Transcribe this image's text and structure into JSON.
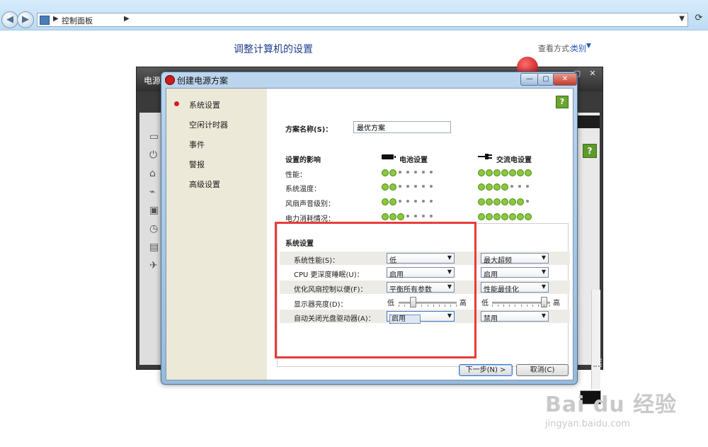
{
  "explorer": {
    "breadcrumb": "控制面板",
    "page_title": "调整计算机的设置",
    "view_label": "查看方式:",
    "view_value": "类别"
  },
  "background_window": {
    "title": "电源",
    "help_glyph": "?"
  },
  "dialog": {
    "title": "创建电源方案",
    "help_glyph": "?",
    "sidebar": [
      "系统设置",
      "空闲计时器",
      "事件",
      "警报",
      "高级设置"
    ],
    "active_sidebar_index": 0,
    "plan_name_label": "方案名称(S)：",
    "plan_name_value": "最优方案",
    "impact": {
      "header": "设置的影响",
      "battery_header": "电池设置",
      "ac_header": "交流电设置",
      "rows": [
        {
          "label": "性能：",
          "battery_level": 2,
          "ac_level": 7
        },
        {
          "label": "系统温度：",
          "battery_level": 2,
          "ac_level": 4
        },
        {
          "label": "风扇声音级别：",
          "battery_level": 2,
          "ac_level": 6
        },
        {
          "label": "电力消耗情况：",
          "battery_level": 3,
          "ac_level": 7
        }
      ],
      "max_level": 7
    },
    "system_settings": {
      "header": "系统设置",
      "rows": [
        {
          "label": "系统性能(S)：",
          "battery": "低",
          "ac": "最大超频",
          "type": "select"
        },
        {
          "label": "CPU 更深度睡眠(U)：",
          "battery": "启用",
          "ac": "启用",
          "type": "select"
        },
        {
          "label": "优化风扇控制以便(F)：",
          "battery": "平衡所有参数",
          "ac": "性能最佳化",
          "type": "select"
        },
        {
          "label": "显示器亮度(D)：",
          "battery_min": "低",
          "battery_max": "高",
          "ac_min": "低",
          "ac_max": "高",
          "battery_value": 0.22,
          "ac_value": 0.95,
          "type": "slider"
        },
        {
          "label": "自动关闭光盘驱动器(A)：",
          "battery": "启用",
          "ac": "禁用",
          "type": "select"
        }
      ]
    },
    "buttons": {
      "next": "下一步(N) >",
      "cancel": "取消(C)"
    }
  },
  "watermark": {
    "line1": "Bai du 经验",
    "line2": "jingyan.baidu.com"
  },
  "colors": {
    "dot_on": "#8ac83c",
    "highlight": "#e83b3b",
    "title_blue": "#1e3f8a"
  }
}
